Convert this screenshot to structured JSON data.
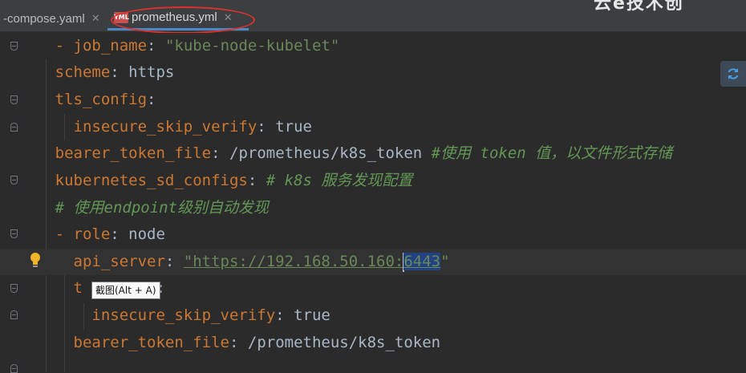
{
  "tabs": [
    {
      "label": "-compose.yaml",
      "close": "✕"
    },
    {
      "label": "prometheus.yml",
      "close": "✕",
      "icon": "yml-file-icon",
      "icon_text": "YML"
    }
  ],
  "watermark_text": "云e技术创",
  "editor": {
    "lines": [
      {
        "key": "- job_name",
        "value": "\"kube-node-kubelet\""
      },
      {
        "key": "scheme",
        "value": "https"
      },
      {
        "key": "tls_config",
        "value": ""
      },
      {
        "key": "insecure_skip_verify",
        "value": "true"
      },
      {
        "key": "bearer_token_file",
        "value": "/prometheus/k8s_token",
        "comment": "#使用 token 值，以文件形式存储"
      },
      {
        "key": "kubernetes_sd_configs",
        "value": "",
        "comment": "# k8s 服务发现配置"
      },
      {
        "comment": "# 使用endpoint级别自动发现"
      },
      {
        "key": "- role",
        "value": "node"
      },
      {
        "key": "api_server",
        "value_pre": "\"https://192.168.50.160:",
        "value_sel": "6443",
        "value_post": "\""
      },
      {
        "key_pre": "t",
        "key_post": "ig",
        "value": ""
      },
      {
        "key": "insecure_skip_verify",
        "value": "true"
      },
      {
        "key": "bearer_token_file",
        "value": "/prometheus/k8s_token"
      }
    ]
  },
  "tooltip": "截图(Alt + A)",
  "colors": {
    "accent": "#4a88c7",
    "annotation": "#e0302c",
    "selection": "#214283"
  }
}
